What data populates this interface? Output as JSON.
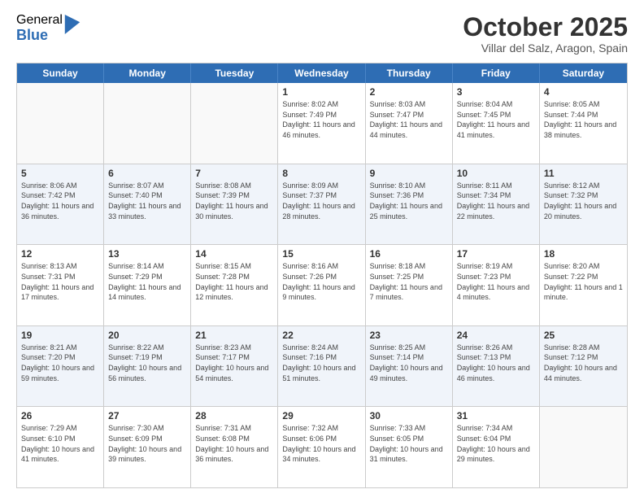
{
  "header": {
    "logo_general": "General",
    "logo_blue": "Blue",
    "month_title": "October 2025",
    "location": "Villar del Salz, Aragon, Spain"
  },
  "days_of_week": [
    "Sunday",
    "Monday",
    "Tuesday",
    "Wednesday",
    "Thursday",
    "Friday",
    "Saturday"
  ],
  "weeks": [
    {
      "alt": false,
      "cells": [
        {
          "day": "",
          "empty": true,
          "info": ""
        },
        {
          "day": "",
          "empty": true,
          "info": ""
        },
        {
          "day": "",
          "empty": true,
          "info": ""
        },
        {
          "day": "1",
          "empty": false,
          "info": "Sunrise: 8:02 AM\nSunset: 7:49 PM\nDaylight: 11 hours\nand 46 minutes."
        },
        {
          "day": "2",
          "empty": false,
          "info": "Sunrise: 8:03 AM\nSunset: 7:47 PM\nDaylight: 11 hours\nand 44 minutes."
        },
        {
          "day": "3",
          "empty": false,
          "info": "Sunrise: 8:04 AM\nSunset: 7:45 PM\nDaylight: 11 hours\nand 41 minutes."
        },
        {
          "day": "4",
          "empty": false,
          "info": "Sunrise: 8:05 AM\nSunset: 7:44 PM\nDaylight: 11 hours\nand 38 minutes."
        }
      ]
    },
    {
      "alt": true,
      "cells": [
        {
          "day": "5",
          "empty": false,
          "info": "Sunrise: 8:06 AM\nSunset: 7:42 PM\nDaylight: 11 hours\nand 36 minutes."
        },
        {
          "day": "6",
          "empty": false,
          "info": "Sunrise: 8:07 AM\nSunset: 7:40 PM\nDaylight: 11 hours\nand 33 minutes."
        },
        {
          "day": "7",
          "empty": false,
          "info": "Sunrise: 8:08 AM\nSunset: 7:39 PM\nDaylight: 11 hours\nand 30 minutes."
        },
        {
          "day": "8",
          "empty": false,
          "info": "Sunrise: 8:09 AM\nSunset: 7:37 PM\nDaylight: 11 hours\nand 28 minutes."
        },
        {
          "day": "9",
          "empty": false,
          "info": "Sunrise: 8:10 AM\nSunset: 7:36 PM\nDaylight: 11 hours\nand 25 minutes."
        },
        {
          "day": "10",
          "empty": false,
          "info": "Sunrise: 8:11 AM\nSunset: 7:34 PM\nDaylight: 11 hours\nand 22 minutes."
        },
        {
          "day": "11",
          "empty": false,
          "info": "Sunrise: 8:12 AM\nSunset: 7:32 PM\nDaylight: 11 hours\nand 20 minutes."
        }
      ]
    },
    {
      "alt": false,
      "cells": [
        {
          "day": "12",
          "empty": false,
          "info": "Sunrise: 8:13 AM\nSunset: 7:31 PM\nDaylight: 11 hours\nand 17 minutes."
        },
        {
          "day": "13",
          "empty": false,
          "info": "Sunrise: 8:14 AM\nSunset: 7:29 PM\nDaylight: 11 hours\nand 14 minutes."
        },
        {
          "day": "14",
          "empty": false,
          "info": "Sunrise: 8:15 AM\nSunset: 7:28 PM\nDaylight: 11 hours\nand 12 minutes."
        },
        {
          "day": "15",
          "empty": false,
          "info": "Sunrise: 8:16 AM\nSunset: 7:26 PM\nDaylight: 11 hours\nand 9 minutes."
        },
        {
          "day": "16",
          "empty": false,
          "info": "Sunrise: 8:18 AM\nSunset: 7:25 PM\nDaylight: 11 hours\nand 7 minutes."
        },
        {
          "day": "17",
          "empty": false,
          "info": "Sunrise: 8:19 AM\nSunset: 7:23 PM\nDaylight: 11 hours\nand 4 minutes."
        },
        {
          "day": "18",
          "empty": false,
          "info": "Sunrise: 8:20 AM\nSunset: 7:22 PM\nDaylight: 11 hours\nand 1 minute."
        }
      ]
    },
    {
      "alt": true,
      "cells": [
        {
          "day": "19",
          "empty": false,
          "info": "Sunrise: 8:21 AM\nSunset: 7:20 PM\nDaylight: 10 hours\nand 59 minutes."
        },
        {
          "day": "20",
          "empty": false,
          "info": "Sunrise: 8:22 AM\nSunset: 7:19 PM\nDaylight: 10 hours\nand 56 minutes."
        },
        {
          "day": "21",
          "empty": false,
          "info": "Sunrise: 8:23 AM\nSunset: 7:17 PM\nDaylight: 10 hours\nand 54 minutes."
        },
        {
          "day": "22",
          "empty": false,
          "info": "Sunrise: 8:24 AM\nSunset: 7:16 PM\nDaylight: 10 hours\nand 51 minutes."
        },
        {
          "day": "23",
          "empty": false,
          "info": "Sunrise: 8:25 AM\nSunset: 7:14 PM\nDaylight: 10 hours\nand 49 minutes."
        },
        {
          "day": "24",
          "empty": false,
          "info": "Sunrise: 8:26 AM\nSunset: 7:13 PM\nDaylight: 10 hours\nand 46 minutes."
        },
        {
          "day": "25",
          "empty": false,
          "info": "Sunrise: 8:28 AM\nSunset: 7:12 PM\nDaylight: 10 hours\nand 44 minutes."
        }
      ]
    },
    {
      "alt": false,
      "cells": [
        {
          "day": "26",
          "empty": false,
          "info": "Sunrise: 7:29 AM\nSunset: 6:10 PM\nDaylight: 10 hours\nand 41 minutes."
        },
        {
          "day": "27",
          "empty": false,
          "info": "Sunrise: 7:30 AM\nSunset: 6:09 PM\nDaylight: 10 hours\nand 39 minutes."
        },
        {
          "day": "28",
          "empty": false,
          "info": "Sunrise: 7:31 AM\nSunset: 6:08 PM\nDaylight: 10 hours\nand 36 minutes."
        },
        {
          "day": "29",
          "empty": false,
          "info": "Sunrise: 7:32 AM\nSunset: 6:06 PM\nDaylight: 10 hours\nand 34 minutes."
        },
        {
          "day": "30",
          "empty": false,
          "info": "Sunrise: 7:33 AM\nSunset: 6:05 PM\nDaylight: 10 hours\nand 31 minutes."
        },
        {
          "day": "31",
          "empty": false,
          "info": "Sunrise: 7:34 AM\nSunset: 6:04 PM\nDaylight: 10 hours\nand 29 minutes."
        },
        {
          "day": "",
          "empty": true,
          "info": ""
        }
      ]
    }
  ]
}
